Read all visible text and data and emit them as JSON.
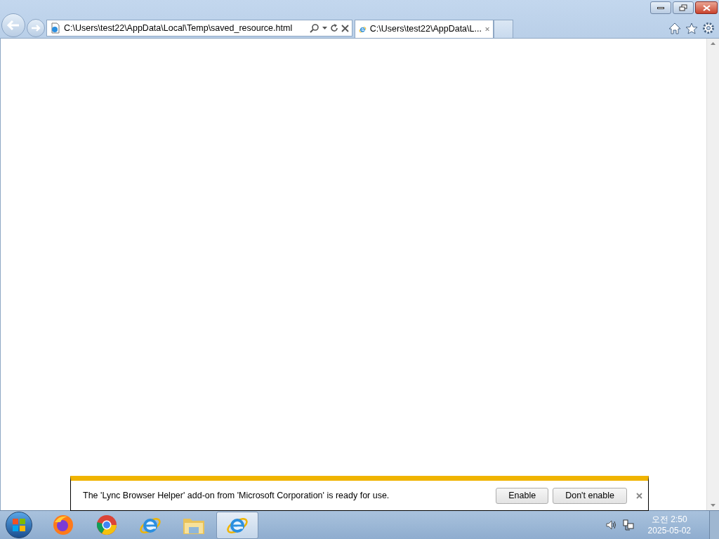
{
  "window": {
    "address": "C:\\Users\\test22\\AppData\\Local\\Temp\\saved_resource.html",
    "tabs": [
      {
        "title": "C:\\Users\\test22\\AppData\\L...",
        "selected": true
      }
    ]
  },
  "notification": {
    "message": "The 'Lync Browser Helper' add-on from 'Microsoft Corporation' is ready for use.",
    "buttons": [
      "Enable",
      "Don't enable"
    ]
  },
  "taskbar": {
    "apps": [
      {
        "kind": "firefox",
        "selected": false
      },
      {
        "kind": "chrome",
        "selected": false
      },
      {
        "kind": "ie",
        "selected": false
      },
      {
        "kind": "explorer",
        "selected": false
      },
      {
        "kind": "ie",
        "selected": true
      }
    ],
    "time": "오전 2:50",
    "date": "2025-05-02"
  }
}
